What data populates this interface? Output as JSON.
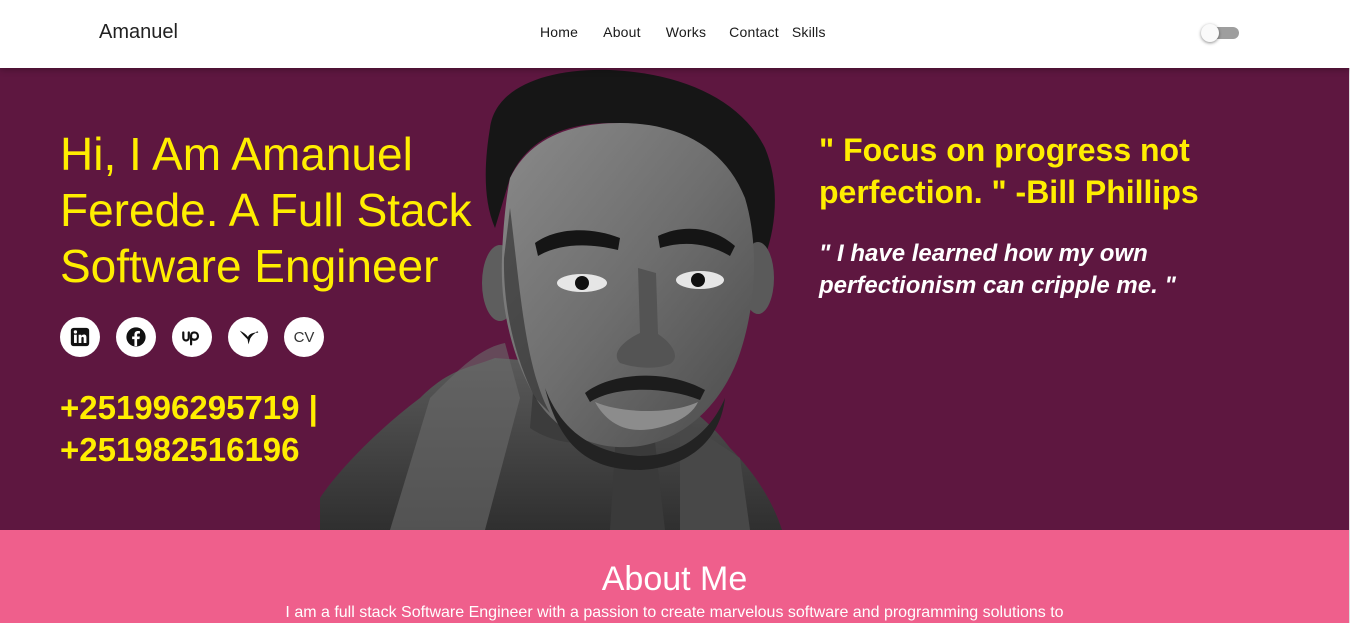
{
  "header": {
    "brand": "Amanuel",
    "nav": {
      "home": "Home",
      "about": "About",
      "works": "Works",
      "contact": "Contact",
      "skills": "Skills"
    },
    "theme_toggle": {
      "state": "off"
    }
  },
  "hero": {
    "headline": "Hi, I Am Amanuel Ferede. A Full Stack Software Engineer",
    "socials": [
      {
        "icon": "linkedin-icon"
      },
      {
        "icon": "facebook-icon"
      },
      {
        "icon": "upwork-icon"
      },
      {
        "icon": "hummingbird-icon"
      },
      {
        "label": "CV"
      }
    ],
    "phones": "+251996295719 | +251982516196",
    "quote": "\" Focus on progress not perfection. \" -Bill Phillips",
    "sub_quote": "\" I have learned how my own perfectionism can cripple me. \"",
    "colors": {
      "background": "#5e1740",
      "accent": "#ffee00"
    }
  },
  "about": {
    "title": "About Me",
    "text": "I am a full stack Software Engineer with a passion to create marvelous software and programming solutions to",
    "background": "#ef5f8c"
  }
}
